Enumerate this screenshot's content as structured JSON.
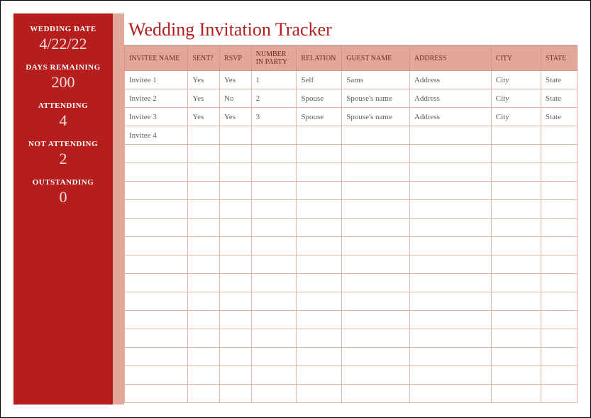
{
  "title": "Wedding Invitation Tracker",
  "sidebar": {
    "wedding_date": {
      "label": "WEDDING DATE",
      "value": "4/22/22"
    },
    "days_remaining": {
      "label": "DAYS REMAINING",
      "value": "200"
    },
    "attending": {
      "label": "ATTENDING",
      "value": "4"
    },
    "not_attending": {
      "label": "NOT ATTENDING",
      "value": "2"
    },
    "outstanding": {
      "label": "OUTSTANDING",
      "value": "0"
    }
  },
  "columns": {
    "name": "INVITEE NAME",
    "sent": "SENT?",
    "rsvp": "RSVP",
    "party": "NUMBER IN PARTY",
    "relation": "RELATION",
    "guest": "GUEST NAME",
    "address": "ADDRESS",
    "city": "CITY",
    "state": "STATE"
  },
  "rows": [
    {
      "name": "Invitee 1",
      "sent": "Yes",
      "rsvp": "Yes",
      "party": "1",
      "relation": "Self",
      "guest": "Sams",
      "address": "Address",
      "city": "City",
      "state": "State"
    },
    {
      "name": "Invitee 2",
      "sent": "Yes",
      "rsvp": "No",
      "party": "2",
      "relation": "Spouse",
      "guest": "Spouse's name",
      "address": "Address",
      "city": "City",
      "state": "State"
    },
    {
      "name": "Invitee 3",
      "sent": "Yes",
      "rsvp": "Yes",
      "party": "3",
      "relation": "Spouse",
      "guest": "Spouse's name",
      "address": "Address",
      "city": "City",
      "state": "State"
    },
    {
      "name": "Invitee 4",
      "sent": "",
      "rsvp": "",
      "party": "",
      "relation": "",
      "guest": "",
      "address": "",
      "city": "",
      "state": ""
    }
  ],
  "empty_row_count": 14,
  "chart_data": {
    "type": "table",
    "title": "Wedding Invitation Tracker",
    "columns": [
      "INVITEE NAME",
      "SENT?",
      "RSVP",
      "NUMBER IN PARTY",
      "RELATION",
      "GUEST NAME",
      "ADDRESS",
      "CITY",
      "STATE"
    ],
    "rows": [
      [
        "Invitee 1",
        "Yes",
        "Yes",
        "1",
        "Self",
        "Sams",
        "Address",
        "City",
        "State"
      ],
      [
        "Invitee 2",
        "Yes",
        "No",
        "2",
        "Spouse",
        "Spouse's name",
        "Address",
        "City",
        "State"
      ],
      [
        "Invitee 3",
        "Yes",
        "Yes",
        "3",
        "Spouse",
        "Spouse's name",
        "Address",
        "City",
        "State"
      ],
      [
        "Invitee 4",
        "",
        "",
        "",
        "",
        "",
        "",
        "",
        ""
      ]
    ],
    "summary": {
      "WEDDING DATE": "4/22/22",
      "DAYS REMAINING": 200,
      "ATTENDING": 4,
      "NOT ATTENDING": 2,
      "OUTSTANDING": 0
    }
  }
}
